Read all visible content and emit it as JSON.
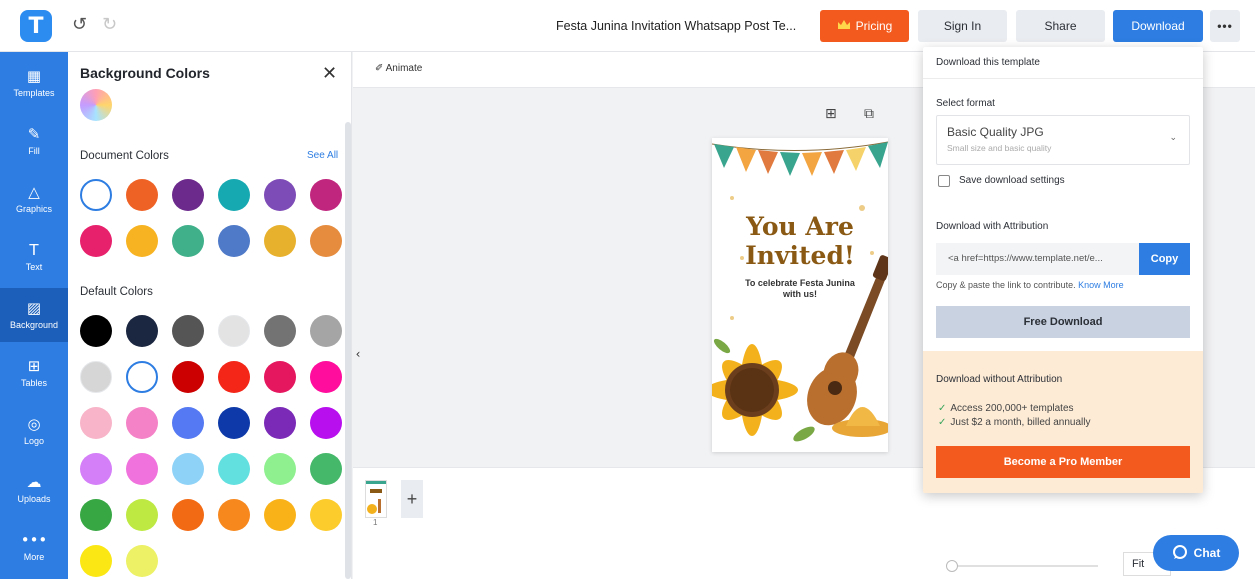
{
  "app": {
    "logo_letter": "T"
  },
  "header": {
    "undo_icon": "↺",
    "redo_icon": "↻",
    "doc_title": "Festa Junina Invitation Whatsapp Post Te...",
    "pricing_label": "Pricing",
    "signin_label": "Sign In",
    "share_label": "Share",
    "download_label": "Download",
    "more_label": "•••"
  },
  "sidebar": {
    "items": [
      {
        "label": "Templates",
        "icon": "▦"
      },
      {
        "label": "Fill",
        "icon": "✎"
      },
      {
        "label": "Graphics",
        "icon": "△"
      },
      {
        "label": "Text",
        "icon": "T"
      },
      {
        "label": "Background",
        "icon": "▨"
      },
      {
        "label": "Tables",
        "icon": "⊞"
      },
      {
        "label": "Logo",
        "icon": "◎"
      },
      {
        "label": "Uploads",
        "icon": "☁"
      },
      {
        "label": "More",
        "icon": "•••"
      }
    ]
  },
  "color_panel": {
    "title": "Background Colors",
    "close_icon": "✕",
    "document_colors_title": "Document Colors",
    "see_all": "See All",
    "default_colors_title": "Default Colors",
    "document_colors": [
      "#ffffff",
      "#ef6226",
      "#6c2a8c",
      "#17a9b2",
      "#7e4cb6",
      "#c0267e",
      "#e8216c",
      "#f7b321",
      "#3fb08a",
      "#4f7ac8",
      "#e8b12d",
      "#e58c3f"
    ],
    "default_colors": [
      "#000000",
      "#1b2640",
      "#555555",
      "#e3e3e3",
      "#737373",
      "#a5a5a5",
      "#d6d6d6",
      "#ffffff",
      "#cc0000",
      "#f32617",
      "#e5175e",
      "#ff0d9c",
      "#f8b4c8",
      "#f482c6",
      "#5479f2",
      "#0d3aa8",
      "#7a2ab6",
      "#b70fee",
      "#d47ef8",
      "#f072dc",
      "#8fd2f8",
      "#62e0e0",
      "#8ff08f",
      "#45b86a",
      "#36a743",
      "#bde942",
      "#f36a14",
      "#f7881e",
      "#fab219",
      "#fccb2c",
      "#fbe713",
      "#ecf165"
    ],
    "outlined_swatch": "#ffffff"
  },
  "canvas": {
    "animate_label": "Animate",
    "add_icon": "⊞",
    "copy_icon": "⧉",
    "card": {
      "title_line1": "You Are",
      "title_line2": "Invited!",
      "subtitle": "To celebrate Festa Junina with us!"
    },
    "collapse_icon": "‹",
    "page_number": "1",
    "add_page": "+",
    "zoom_label": "Fit"
  },
  "download_menu": {
    "header": "Download this template",
    "select_format_label": "Select format",
    "format_value": "Basic Quality JPG",
    "format_desc": "Small size and basic quality",
    "save_settings_label": "Save download settings",
    "attribution_title": "Download with Attribution",
    "attribution_code": "<a href=https://www.template.net/e...",
    "copy_label": "Copy",
    "attribution_hint": "Copy & paste the link to contribute.",
    "know_more": "Know More",
    "free_download": "Free Download",
    "no_attribution_title": "Download without Attribution",
    "benefits": [
      "Access 200,000+ templates",
      "Just $2 a month, billed annually"
    ],
    "pro_button": "Become a Pro Member"
  },
  "chat": {
    "label": "Chat"
  }
}
